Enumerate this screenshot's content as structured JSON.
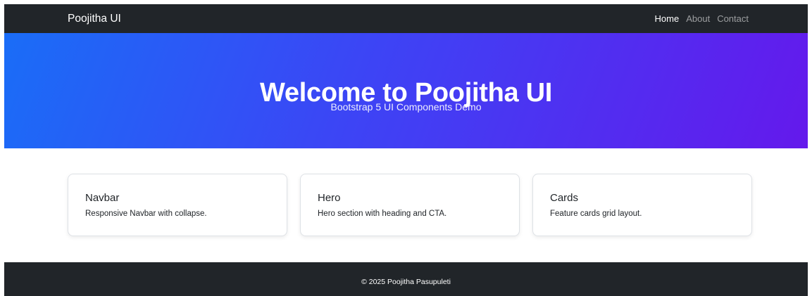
{
  "navbar": {
    "brand": "Poojitha UI",
    "links": [
      {
        "label": "Home",
        "active": true
      },
      {
        "label": "About",
        "active": false
      },
      {
        "label": "Contact",
        "active": false
      }
    ]
  },
  "hero": {
    "title": "Welcome to Poojitha UI",
    "subtitle": "Bootstrap 5 UI Components Demo",
    "gradient_start": "#1a6df7",
    "gradient_end": "#6419ec"
  },
  "cards": [
    {
      "title": "Navbar",
      "text": "Responsive Navbar with collapse."
    },
    {
      "title": "Hero",
      "text": "Hero section with heading and CTA."
    },
    {
      "title": "Cards",
      "text": "Feature cards grid layout."
    }
  ],
  "footer": {
    "text": "© 2025 Poojitha Pasupuleti"
  },
  "colors": {
    "dark": "#212529",
    "white": "#ffffff"
  }
}
